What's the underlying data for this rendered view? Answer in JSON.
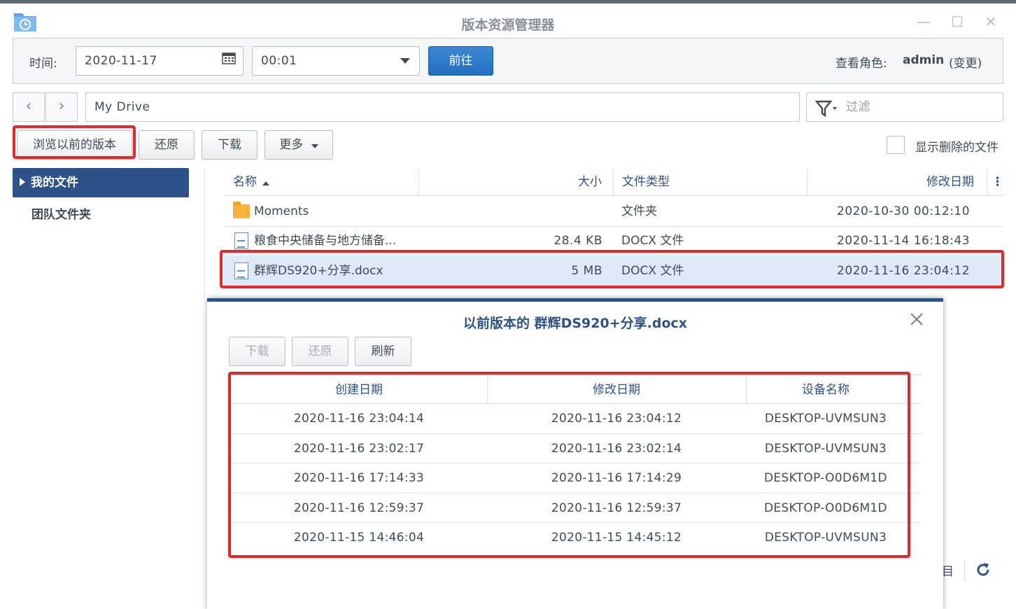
{
  "window": {
    "title": "版本资源管理器",
    "minimize": "—",
    "maximize": "☐",
    "close": "✕"
  },
  "toolbar": {
    "time_label": "时间:",
    "date_value": "2020-11-17",
    "time_value": "00:01",
    "go_label": "前往",
    "role_label": "查看角色:",
    "role_user": "admin",
    "role_change": "(变更)"
  },
  "nav": {
    "back": "‹",
    "forward": "›",
    "path": "My Drive",
    "filter_placeholder": "过滤"
  },
  "actions": {
    "browse_prev": "浏览以前的版本",
    "restore": "还原",
    "download": "下载",
    "more": "更多",
    "show_deleted": "显示删除的文件"
  },
  "sidebar": {
    "items": [
      {
        "label": "我的文件"
      },
      {
        "label": "团队文件夹"
      }
    ]
  },
  "file_table": {
    "headers": {
      "name": "名称",
      "size": "大小",
      "type": "文件类型",
      "modified": "修改日期"
    },
    "rows": [
      {
        "name": "Moments",
        "size": "",
        "type": "文件夹",
        "modified": "2020-10-30 00:12:10"
      },
      {
        "name": "粮食中央储备与地方储备...",
        "size": "28.4 KB",
        "type": "DOCX 文件",
        "modified": "2020-11-14 16:18:43"
      },
      {
        "name": "群辉DS920+分享.docx",
        "size": "5 MB",
        "type": "DOCX 文件",
        "modified": "2020-11-16 23:04:12"
      }
    ]
  },
  "dialog": {
    "title": "以前版本的 群辉DS920+分享.docx",
    "download": "下载",
    "restore": "还原",
    "refresh": "刷新",
    "headers": {
      "created": "创建日期",
      "modified": "修改日期",
      "device": "设备名称"
    },
    "rows": [
      {
        "created": "2020-11-16 23:04:14",
        "modified": "2020-11-16 23:04:12",
        "device": "DESKTOP-UVMSUN3"
      },
      {
        "created": "2020-11-16 23:02:17",
        "modified": "2020-11-16 23:02:14",
        "device": "DESKTOP-UVMSUN3"
      },
      {
        "created": "2020-11-16 17:14:33",
        "modified": "2020-11-16 17:14:29",
        "device": "DESKTOP-O0D6M1D"
      },
      {
        "created": "2020-11-16 12:59:37",
        "modified": "2020-11-16 12:59:37",
        "device": "DESKTOP-O0D6M1D"
      },
      {
        "created": "2020-11-15 14:46:04",
        "modified": "2020-11-15 14:45:12",
        "device": "DESKTOP-UVMSUN3"
      }
    ]
  },
  "behind_dialog": {
    "partial_text": "目"
  },
  "colors": {
    "accent": "#2d5288",
    "primary_button": "#2e7bcb",
    "highlight": "#e8262a",
    "selected_row": "#dde9f7"
  }
}
